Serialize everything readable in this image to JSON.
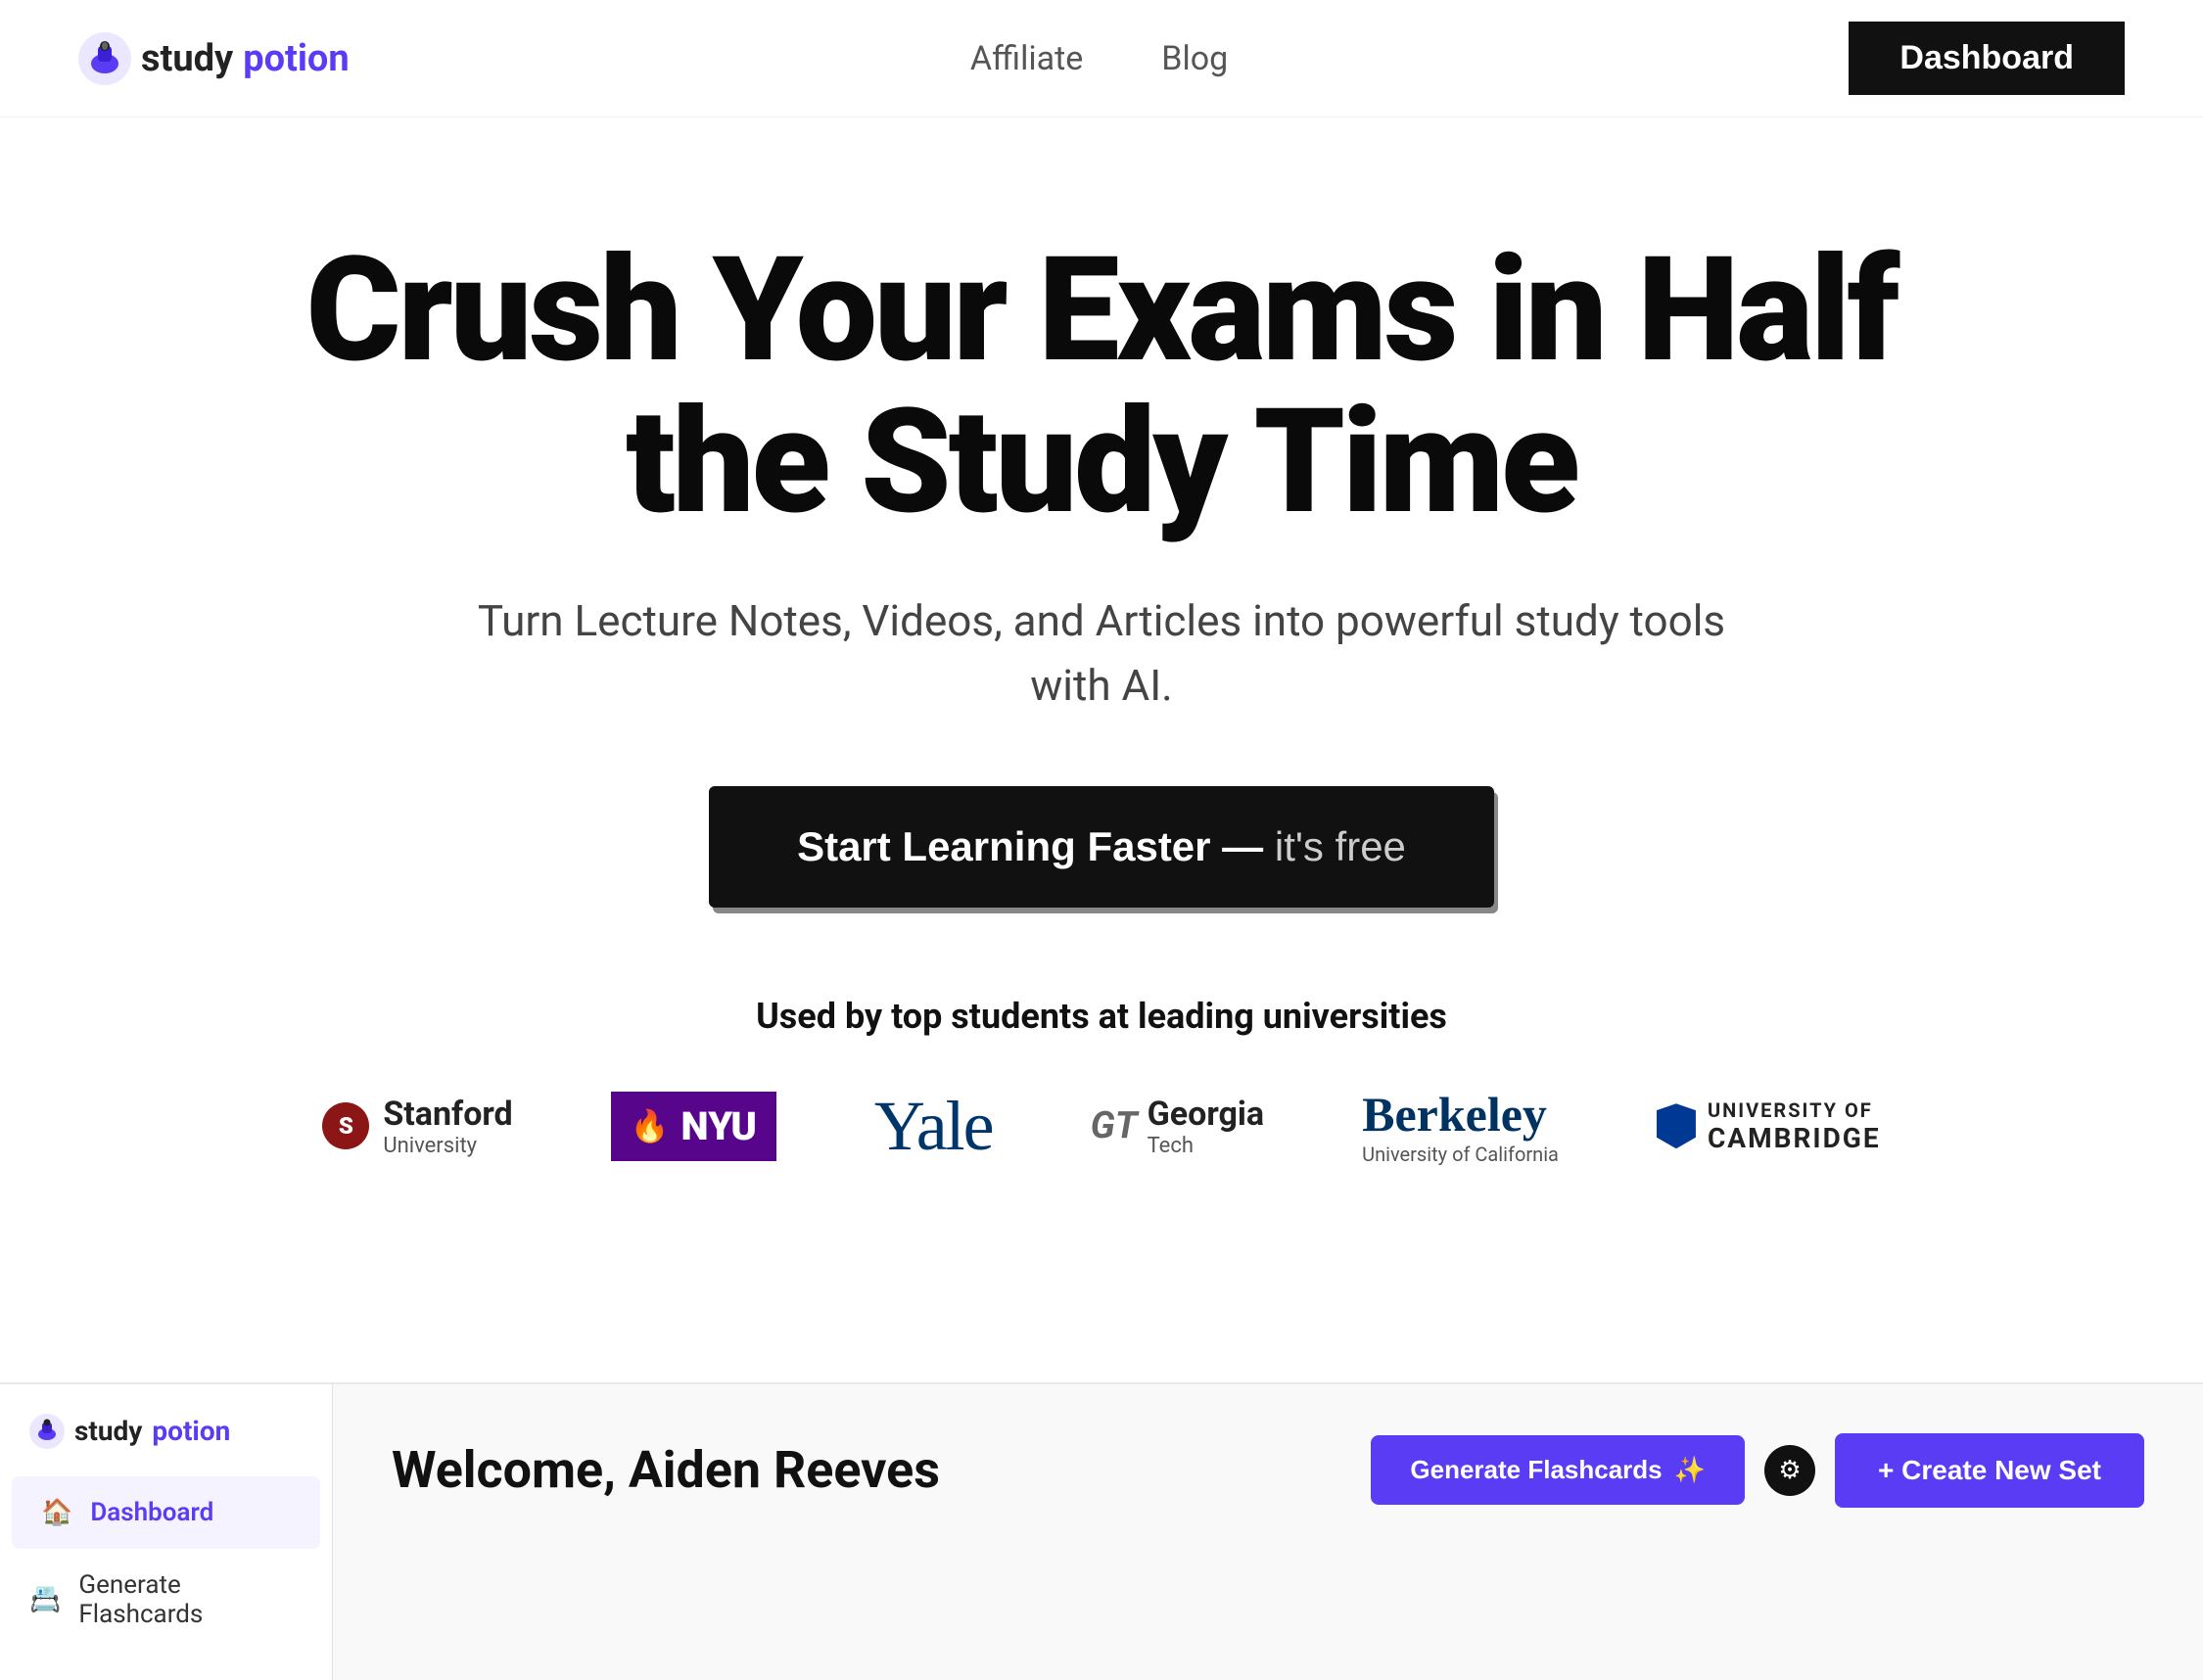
{
  "nav": {
    "logo_study": "study",
    "logo_potion": "potion",
    "links": [
      {
        "label": "Affiliate",
        "href": "#"
      },
      {
        "label": "Blog",
        "href": "#"
      }
    ],
    "dashboard_btn": "Dashboard"
  },
  "hero": {
    "title": "Crush Your Exams in Half the Study Time",
    "subtitle": "Turn Lecture Notes, Videos, and Articles into powerful study tools\nwith AI.",
    "cta_main": "Start Learning Faster",
    "cta_em_dash": " — ",
    "cta_free": "it's free"
  },
  "universities": {
    "label": "Used by top students at leading universities",
    "logos": [
      {
        "name": "Stanford University",
        "sub": "University",
        "type": "stanford"
      },
      {
        "name": "NYU",
        "type": "nyu"
      },
      {
        "name": "Yale",
        "type": "yale"
      },
      {
        "name": "Georgia Tech",
        "type": "gt"
      },
      {
        "name": "Berkeley",
        "sub": "University of California",
        "type": "berkeley"
      },
      {
        "name": "University of Cambridge",
        "type": "cambridge"
      }
    ]
  },
  "dashboard_preview": {
    "sidebar": {
      "logo_study": "study",
      "logo_potion": "potion",
      "nav_items": [
        {
          "label": "Dashboard",
          "icon": "🏠",
          "active": true
        },
        {
          "label": "Generate Flashcards",
          "icon": "📇",
          "active": false
        }
      ]
    },
    "main": {
      "welcome": "Welcome, Aiden Reeves",
      "generate_btn": "Generate Flashcards",
      "create_btn": "+ Create New Set"
    }
  }
}
